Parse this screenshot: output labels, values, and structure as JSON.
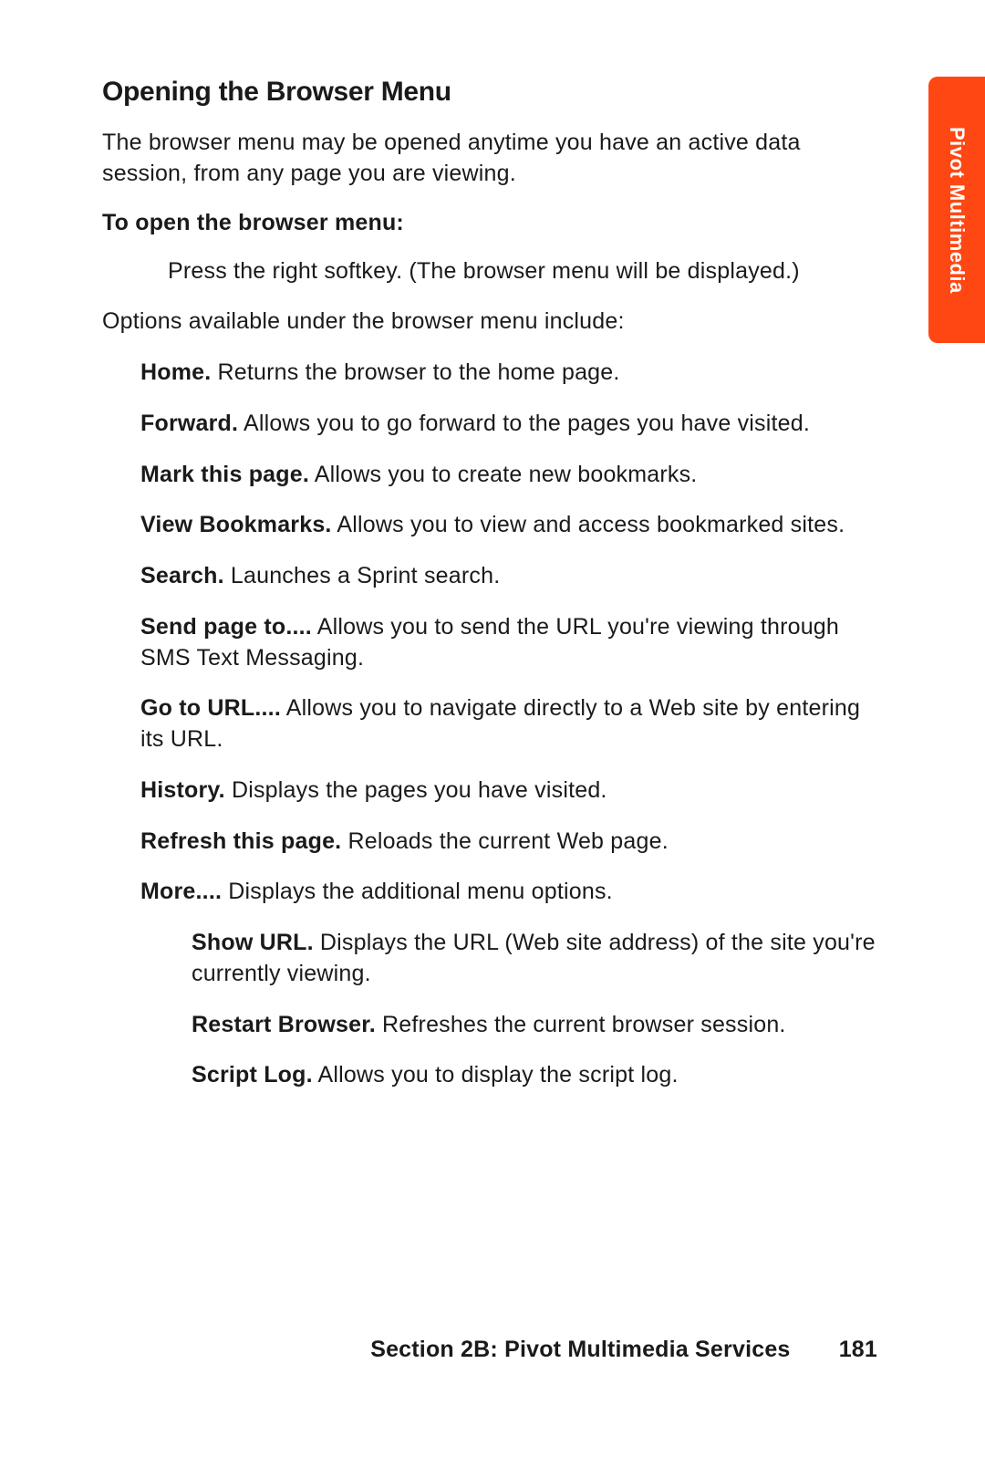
{
  "side_tab": "Pivot Multimedia",
  "heading": "Opening the Browser Menu",
  "intro": "The browser menu may be opened anytime you have an active data session, from any page you are viewing.",
  "subhead": "To open the browser menu:",
  "step": "Press the right softkey. (The browser menu will be displayed.)",
  "options_lead": "Options available under the browser menu include:",
  "options": [
    {
      "name": "Home.",
      "desc": " Returns the browser to the home page."
    },
    {
      "name": "Forward.",
      "desc": " Allows you to go forward to the pages you have visited."
    },
    {
      "name": "Mark this page.",
      "desc": " Allows you to create new bookmarks."
    },
    {
      "name": "View Bookmarks.",
      "desc": " Allows you to view and access bookmarked sites."
    },
    {
      "name": "Search.",
      "desc": " Launches a Sprint search."
    },
    {
      "name": "Send page to....",
      "desc": " Allows you to send the URL you're viewing through SMS Text Messaging."
    },
    {
      "name": "Go to URL....",
      "desc": " Allows you to navigate directly to a Web site by entering its URL."
    },
    {
      "name": "History.",
      "desc": " Displays the pages you have visited."
    },
    {
      "name": "Refresh this page.",
      "desc": " Reloads the current Web page."
    },
    {
      "name": "More....",
      "desc": " Displays the additional menu options."
    }
  ],
  "more_sub": [
    {
      "name": "Show URL.",
      "desc": " Displays the URL (Web site address) of the site you're currently viewing."
    },
    {
      "name": "Restart Browser.",
      "desc": " Refreshes the current browser session."
    },
    {
      "name": "Script Log.",
      "desc": " Allows you to display the script log."
    }
  ],
  "footer_section": "Section 2B: Pivot Multimedia Services",
  "footer_page": "181"
}
